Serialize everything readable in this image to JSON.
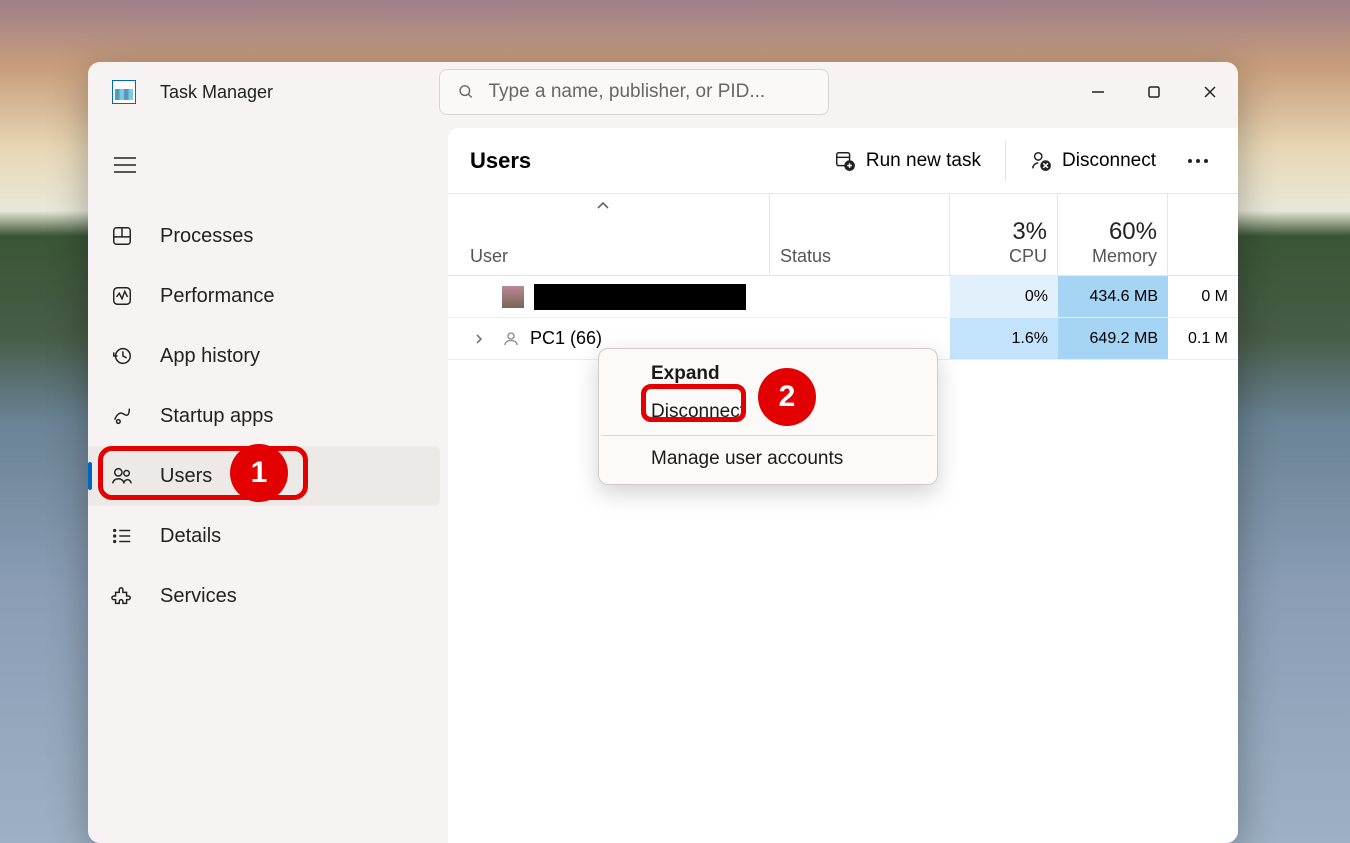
{
  "app": {
    "title": "Task Manager"
  },
  "search": {
    "placeholder": "Type a name, publisher, or PID..."
  },
  "nav": {
    "processes": "Processes",
    "performance": "Performance",
    "apphistory": "App history",
    "startup": "Startup apps",
    "users": "Users",
    "details": "Details",
    "services": "Services"
  },
  "page": {
    "title": "Users",
    "run_new_task": "Run new task",
    "disconnect": "Disconnect"
  },
  "cols": {
    "user": "User",
    "status": "Status",
    "cpu_pct": "3%",
    "cpu_label": "CPU",
    "mem_pct": "60%",
    "mem_label": "Memory"
  },
  "rows": [
    {
      "name": "",
      "cpu": "0%",
      "mem": "434.6 MB",
      "net": "0 M"
    },
    {
      "name": "PC1 (66)",
      "cpu": "1.6%",
      "mem": "649.2 MB",
      "net": "0.1 M"
    }
  ],
  "ctx": {
    "expand": "Expand",
    "disconnect": "Disconnect",
    "manage": "Manage user accounts"
  },
  "annot": {
    "one": "1",
    "two": "2"
  }
}
